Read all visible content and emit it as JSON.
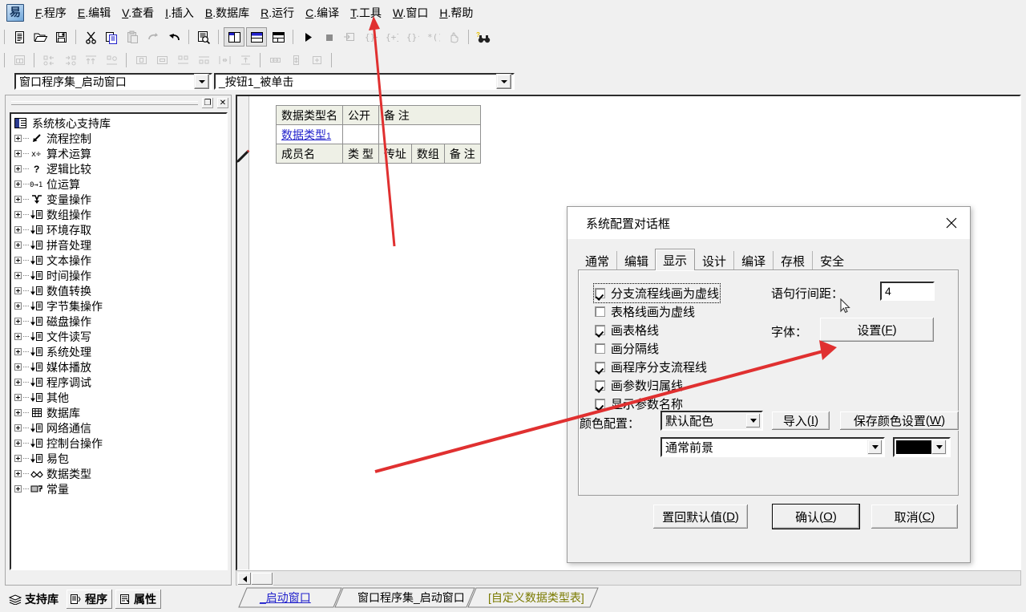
{
  "app": {
    "logo_char": "易",
    "menu": [
      {
        "accel": "F",
        "label": "程序"
      },
      {
        "accel": "E",
        "label": "编辑"
      },
      {
        "accel": "V",
        "label": "查看"
      },
      {
        "accel": "I",
        "label": "插入"
      },
      {
        "accel": "B",
        "label": "数据库"
      },
      {
        "accel": "R",
        "label": "运行"
      },
      {
        "accel": "C",
        "label": "编译"
      },
      {
        "accel": "T",
        "label": "工具"
      },
      {
        "accel": "W",
        "label": "窗口"
      },
      {
        "accel": "H",
        "label": "帮助"
      }
    ]
  },
  "toolbar_main": {
    "icons": [
      "new-file-icon",
      "open-folder-icon",
      "save-disk-icon",
      "sep",
      "cut-scissors-icon",
      "copy-icon",
      "paste-icon",
      "redo-icon",
      "undo-icon",
      "sep",
      "find-in-page-icon",
      "sep",
      "layout-left-panel-icon",
      "layout-top-panel-icon",
      "layout-grid-panel-icon",
      "sep",
      "run-play-icon",
      "stop-square-icon",
      "step-into-form-icon",
      "step-over-icon",
      "step-curly-icon",
      "step-out-icon",
      "step-to-cursor-icon",
      "hand-pause-icon",
      "sep",
      "find-binoculars-icon"
    ]
  },
  "toolbar_align": {
    "icons": [
      "form-frame-icon",
      "sep",
      "align-left-icon",
      "align-right-icon",
      "align-top-icon",
      "align-bottom-icon",
      "sep",
      "center-horizontal-icon",
      "center-vertical-icon",
      "spread-top-icon",
      "spread-bottom-icon",
      "equal-h-gap-icon",
      "equal-v-gap-icon",
      "sep",
      "same-width-icon",
      "same-height-icon",
      "same-size-icon"
    ]
  },
  "combos": {
    "subroutine": "窗口程序集_启动窗口",
    "event": "_按钮1_被单击"
  },
  "sidebar": {
    "caption_buttons": [
      "maximize-icon",
      "close-icon"
    ],
    "tree_root": {
      "icon": "library-book-icon",
      "label": "系统核心支持库"
    },
    "tree_items": [
      {
        "icon": "flow-arrow-icon",
        "label": "流程控制"
      },
      {
        "icon": "arithmetic-icon",
        "label": "算术运算"
      },
      {
        "icon": "question-icon",
        "label": "逻辑比较"
      },
      {
        "icon": "bits-01-icon",
        "label": "位运算"
      },
      {
        "icon": "variable-icon",
        "label": "变量操作"
      },
      {
        "icon": "list-icon",
        "label": "数组操作"
      },
      {
        "icon": "list-icon",
        "label": "环境存取"
      },
      {
        "icon": "list-icon",
        "label": "拼音处理"
      },
      {
        "icon": "list-icon",
        "label": "文本操作"
      },
      {
        "icon": "list-icon",
        "label": "时间操作"
      },
      {
        "icon": "list-icon",
        "label": "数值转换"
      },
      {
        "icon": "list-icon",
        "label": "字节集操作"
      },
      {
        "icon": "list-icon",
        "label": "磁盘操作"
      },
      {
        "icon": "list-icon",
        "label": "文件读写"
      },
      {
        "icon": "list-icon",
        "label": "系统处理"
      },
      {
        "icon": "list-icon",
        "label": "媒体播放"
      },
      {
        "icon": "list-icon",
        "label": "程序调试"
      },
      {
        "icon": "list-icon",
        "label": "其他"
      },
      {
        "icon": "grid-table-icon",
        "label": "数据库"
      },
      {
        "icon": "list-icon",
        "label": "网络通信"
      },
      {
        "icon": "list-icon",
        "label": "控制台操作"
      },
      {
        "icon": "list-icon",
        "label": "易包"
      },
      {
        "icon": "datatype-icon",
        "label": "数据类型"
      },
      {
        "icon": "constant-icon",
        "label": "常量"
      }
    ],
    "bottom_tabs": [
      {
        "icon": "library-stack-icon",
        "label": "支持库",
        "active": true
      },
      {
        "icon": "program-page-icon",
        "label": "程序",
        "active": false
      },
      {
        "icon": "properties-icon",
        "label": "属性",
        "active": false
      }
    ]
  },
  "editor": {
    "table": {
      "type_header": [
        "数据类型名",
        "公开",
        "备 注"
      ],
      "type_row": {
        "name": "数据类型",
        "index": "1",
        "public": "",
        "remark": ""
      },
      "member_header": [
        "成员名",
        "类 型",
        "传址",
        "数组",
        "备 注"
      ]
    },
    "pen_icon": "pen-cursor-icon",
    "hscroll": {
      "left_arrow": "scroll-left-icon"
    }
  },
  "doc_tabs": [
    {
      "label": "_启动窗口",
      "state": "link"
    },
    {
      "label": "窗口程序集_启动窗口",
      "state": "normal"
    },
    {
      "label": "[自定义数据类型表]",
      "state": "active"
    }
  ],
  "dialog": {
    "title": "系统配置对话框",
    "close_icon": "close-x-icon",
    "tabs": [
      {
        "label": "通常",
        "selected": false
      },
      {
        "label": "编辑",
        "selected": false
      },
      {
        "label": "显示",
        "selected": true
      },
      {
        "label": "设计",
        "selected": false
      },
      {
        "label": "编译",
        "selected": false
      },
      {
        "label": "存根",
        "selected": false
      },
      {
        "label": "安全",
        "selected": false
      }
    ],
    "checkboxes": [
      {
        "label": "分支流程线画为虚线",
        "checked": true,
        "focused": true
      },
      {
        "label": "表格线画为虚线",
        "checked": false,
        "focused": false
      },
      {
        "label": "画表格线",
        "checked": true,
        "focused": false
      },
      {
        "label": "画分隔线",
        "checked": false,
        "focused": false
      },
      {
        "label": "画程序分支流程线",
        "checked": true,
        "focused": false
      },
      {
        "label": "画参数归属线",
        "checked": true,
        "focused": false
      },
      {
        "label": "显示参数名称",
        "checked": true,
        "focused": false
      }
    ],
    "line_spacing": {
      "label": "语句行间距：",
      "value": "4"
    },
    "font": {
      "label": "字体：",
      "button_text": "设置",
      "button_accel": "F"
    },
    "color_scheme": {
      "label": "颜色配置：",
      "value": "默认配色",
      "import_button": {
        "text": "导入",
        "accel": "I"
      },
      "save_button": {
        "text": "保存颜色设置",
        "accel": "W"
      }
    },
    "color_item": {
      "value": "通常前景",
      "swatch_color": "#000000"
    },
    "buttons": [
      {
        "text": "置回默认值",
        "accel": "D",
        "default": false
      },
      {
        "text": "确认",
        "accel": "O",
        "default": true
      },
      {
        "text": "取消",
        "accel": "C",
        "default": false
      }
    ]
  },
  "annotations": {
    "arrow_color": "#e03030",
    "arrow_to_tools_menu": "points at 工具 menu",
    "arrow_to_font_settings": "points at 设置(F) button"
  }
}
